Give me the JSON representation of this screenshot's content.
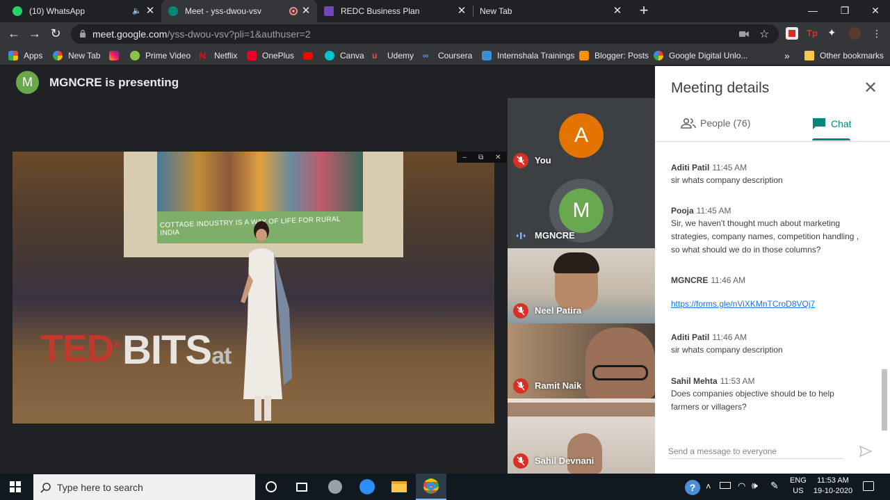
{
  "browser": {
    "tabs": [
      {
        "title": "(10) WhatsApp",
        "icon": "whatsapp-icon",
        "color": "#25d366"
      },
      {
        "title": "Meet - yss-dwou-vsv",
        "icon": "meet-icon",
        "color": "#00897b"
      },
      {
        "title": "REDC Business Plan",
        "icon": "forms-icon",
        "color": "#7248b9"
      },
      {
        "title": "New Tab",
        "icon": "",
        "color": ""
      }
    ],
    "url_host": "meet.google.com",
    "url_path": "/yss-dwou-vsv?pli=1&authuser=2",
    "bookmarks": [
      {
        "label": "Apps",
        "icon": "apps-grid-icon"
      },
      {
        "label": "New Tab",
        "icon": "google-icon"
      },
      {
        "label": "",
        "icon": "instagram-icon"
      },
      {
        "label": "Prime Video",
        "icon": "prime-video-icon"
      },
      {
        "label": "Netflix",
        "icon": "netflix-icon"
      },
      {
        "label": "OnePlus",
        "icon": "oneplus-icon"
      },
      {
        "label": "",
        "icon": "youtube-icon"
      },
      {
        "label": "Canva",
        "icon": "canva-icon"
      },
      {
        "label": "Udemy",
        "icon": "udemy-icon"
      },
      {
        "label": "Coursera",
        "icon": "coursera-icon"
      },
      {
        "label": "Internshala Trainings",
        "icon": "internshala-icon"
      },
      {
        "label": "Blogger: Posts",
        "icon": "blogger-icon"
      },
      {
        "label": "Google Digital Unlo...",
        "icon": "google-icon"
      },
      {
        "label": "»",
        "icon": ""
      },
      {
        "label": "Other bookmarks",
        "icon": "folder-icon"
      }
    ]
  },
  "meet": {
    "presenter_initial": "M",
    "presenting_text": "MGNCRE is presenting",
    "slide_caption": "COTTAGE INDUSTRY IS A WAY OF LIFE FOR RURAL INDIA",
    "stage_logo_ted": "TED",
    "stage_logo_bits": "BITS",
    "stage_logo_suffix": "at",
    "participants": [
      {
        "name": "You",
        "initial": "A",
        "avatar_color": "#e37400",
        "muted": true
      },
      {
        "name": "MGNCRE",
        "initial": "M",
        "avatar_color": "#6aa84f",
        "muted": false
      },
      {
        "name": "Neel Patira",
        "muted": true
      },
      {
        "name": "Ramit Naik",
        "muted": true
      },
      {
        "name": "Sahil Devnani",
        "muted": true
      }
    ]
  },
  "panel": {
    "title": "Meeting details",
    "people_tab": "People (76)",
    "chat_tab": "Chat",
    "messages": [
      {
        "sender": "Aditi Patil",
        "time": "11:45 AM",
        "text": "sir whats company description"
      },
      {
        "sender": "Pooja",
        "time": "11:45 AM",
        "text": "Sir, we haven't thought much about marketing strategies, company names, competition handling , so what should we do in those columns?"
      },
      {
        "sender": "MGNCRE",
        "time": "11:46 AM",
        "text": "https://forms.gle/nViXKMnTCroD8VQj7"
      },
      {
        "sender": "Aditi Patil",
        "time": "11:46 AM",
        "text": "sir whats company description"
      },
      {
        "sender": "Sahil Mehta",
        "time": "11:53 AM",
        "text": "Does companies objective should be to help farmers or villagers?"
      }
    ],
    "compose_placeholder": "Send a message to everyone"
  },
  "taskbar": {
    "search_placeholder": "Type here to search",
    "lang": "ENG",
    "region": "US",
    "time": "11:53 AM",
    "date": "19-10-2020"
  },
  "colors": {
    "meet_accent": "#00897b",
    "mute_red": "#d93025",
    "link_blue": "#1a73e8"
  }
}
